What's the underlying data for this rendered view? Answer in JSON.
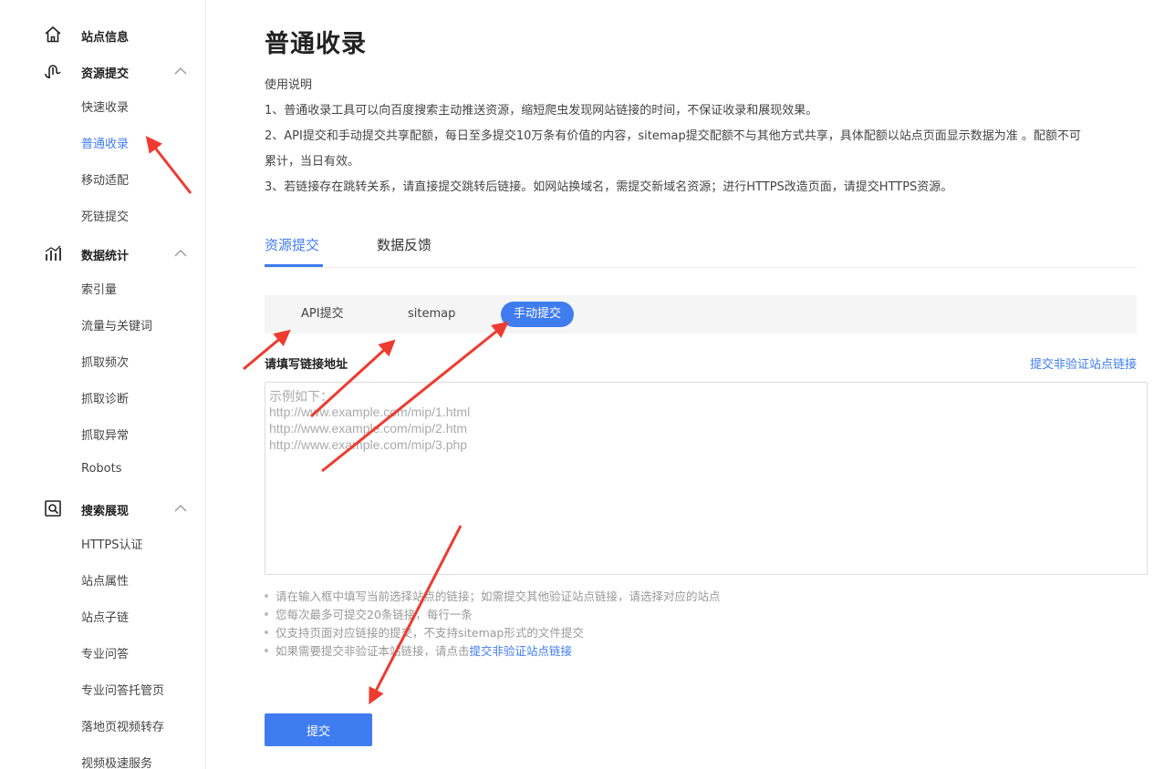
{
  "sidebar": {
    "groups": [
      {
        "label": "站点信息",
        "icon": "home-icon",
        "expanded": false
      },
      {
        "label": "资源提交",
        "icon": "submit-icon",
        "expanded": true,
        "items": [
          "快速收录",
          "普通收录",
          "移动适配",
          "死链提交"
        ]
      },
      {
        "label": "数据统计",
        "icon": "chart-icon",
        "expanded": true,
        "items": [
          "索引量",
          "流量与关键词",
          "抓取频次",
          "抓取诊断",
          "抓取异常",
          "Robots"
        ]
      },
      {
        "label": "搜索展现",
        "icon": "search-icon",
        "expanded": true,
        "items": [
          "HTTPS认证",
          "站点属性",
          "站点子链",
          "专业问答",
          "专业问答托管页",
          "落地页视频转存",
          "视频极速服务"
        ]
      }
    ],
    "active_item": "普通收录"
  },
  "main": {
    "title": "普通收录",
    "usage": {
      "heading": "使用说明",
      "lines": [
        "1、普通收录工具可以向百度搜索主动推送资源，缩短爬虫发现网站链接的时间，不保证收录和展现效果。",
        "2、API提交和手动提交共享配额，每日至多提交10万条有价值的内容，sitemap提交配额不与其他方式共享，具体配额以站点页面显示数据为准 。配额不可",
        "累计，当日有效。",
        "3、若链接存在跳转关系，请直接提交跳转后链接。如网站换域名，需提交新域名资源；进行HTTPS改造页面，请提交HTTPS资源。"
      ]
    },
    "tabs": [
      {
        "label": "资源提交",
        "active": true
      },
      {
        "label": "数据反馈",
        "active": false
      }
    ],
    "methods": [
      {
        "label": "API提交",
        "active": false
      },
      {
        "label": "sitemap",
        "active": false
      },
      {
        "label": "手动提交",
        "active": true
      }
    ],
    "form": {
      "label": "请填写链接地址",
      "alt_link": "提交非验证站点链接",
      "placeholder_lines": [
        "示例如下：",
        "http://www.example.com/mip/1.html",
        "http://www.example.com/mip/2.htm",
        "http://www.example.com/mip/3.php"
      ],
      "value": ""
    },
    "tips": [
      "请在输入框中填写当前选择站点的链接；如需提交其他验证站点链接，请选择对应的站点",
      "您每次最多可提交20条链接，每行一条",
      "仅支持页面对应链接的提交，不支持sitemap形式的文件提交"
    ],
    "tip_last": {
      "text": "如果需要提交非验证本站链接，请点击",
      "link": "提交非验证站点链接"
    },
    "submit_label": "提交"
  },
  "colors": {
    "accent": "#3f7cf0",
    "annotation_arrow": "#ee3b2f"
  }
}
